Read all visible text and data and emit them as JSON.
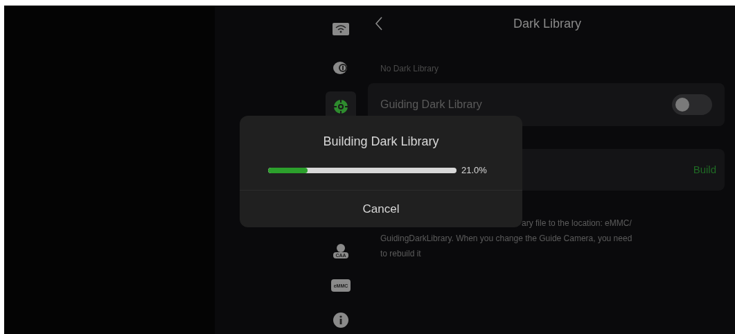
{
  "header": {
    "title": "Dark Library"
  },
  "status": "No Dark Library",
  "sidebar": {
    "items": [
      {
        "kind": "wifi",
        "selected": false
      },
      {
        "kind": "lens",
        "selected": false
      },
      {
        "kind": "guide",
        "selected": true
      },
      {
        "kind": "caa",
        "label": "CAA",
        "selected": false
      },
      {
        "kind": "emmc",
        "label": "eMMC",
        "selected": false
      },
      {
        "kind": "info",
        "selected": false
      }
    ]
  },
  "settings": [
    {
      "kind": "toggle",
      "label": "Guiding Dark Library",
      "on": false
    },
    {
      "kind": "action",
      "action": "Build"
    }
  ],
  "description_lines": [
    "ary file to the location: eMMC/",
    "GuidingDarkLibrary. When you change the Guide Camera, you need",
    "to rebuild it"
  ],
  "dialog": {
    "title": "Building Dark Library",
    "progress": {
      "level": 0.21,
      "reading": "21.0%"
    },
    "button": "Cancel"
  }
}
